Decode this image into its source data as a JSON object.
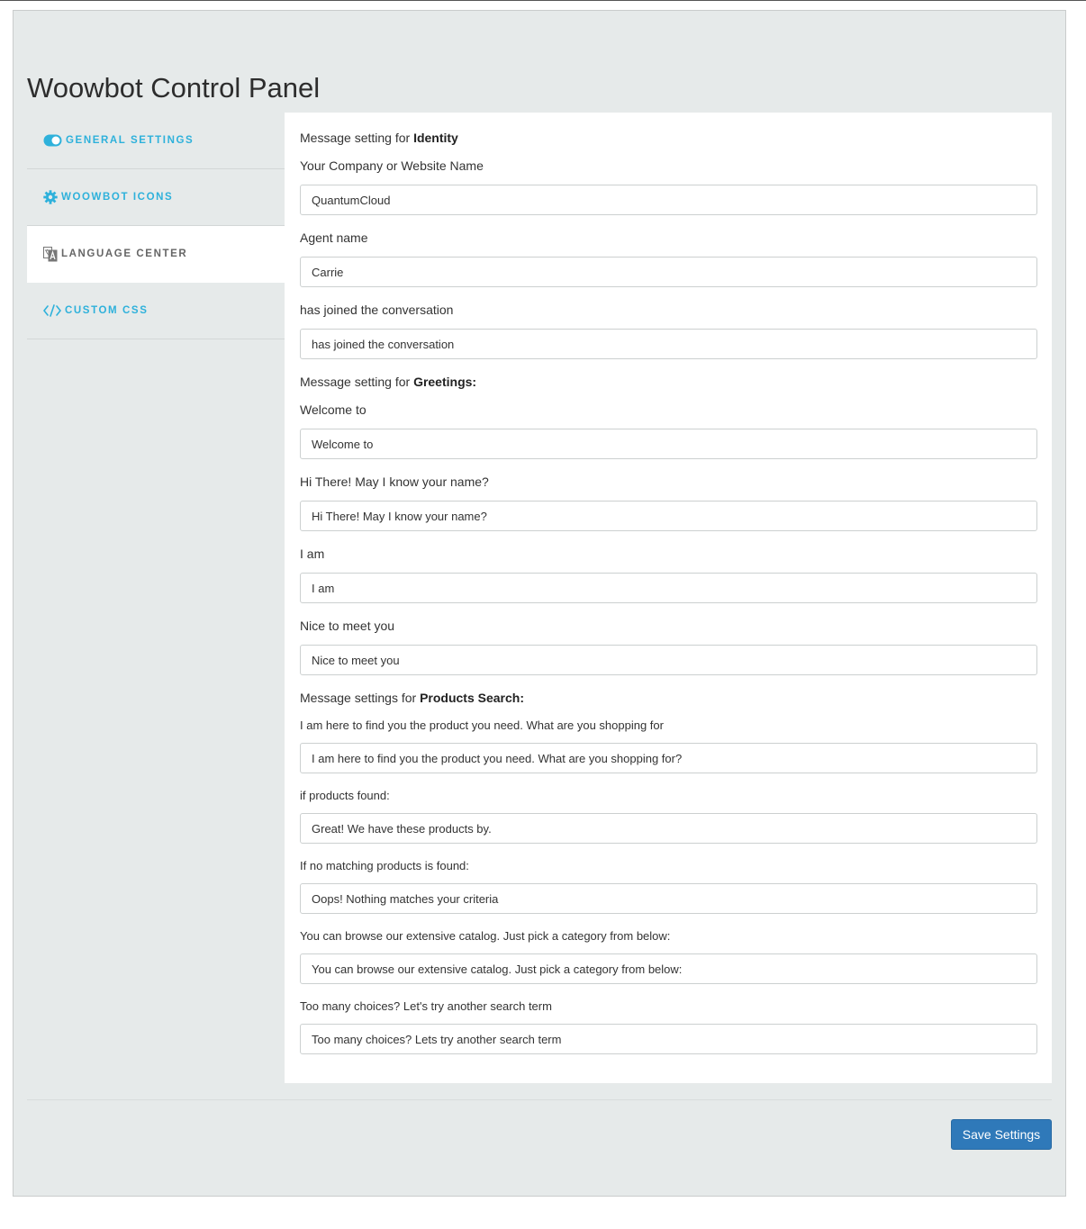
{
  "page": {
    "title": "Woowbot Control Panel"
  },
  "sidebar": {
    "items": [
      {
        "label": "GENERAL SETTINGS",
        "icon": "toggle-icon",
        "active": false
      },
      {
        "label": "WOOWBOT ICONS",
        "icon": "gear-icon",
        "active": false
      },
      {
        "label": "LANGUAGE CENTER",
        "icon": "translate-icon",
        "active": true
      },
      {
        "label": "CUSTOM CSS",
        "icon": "code-icon",
        "active": false
      }
    ]
  },
  "sections": {
    "identity": {
      "prefix": "Message setting for",
      "bold": "Identity"
    },
    "greetings": {
      "prefix": "Message setting for",
      "bold": "Greetings:"
    },
    "products": {
      "prefix": "Message settings for",
      "bold": "Products Search:"
    }
  },
  "fields": {
    "company_name": {
      "label": "Your Company or Website Name",
      "value": "QuantumCloud"
    },
    "agent_name": {
      "label": "Agent name",
      "value": "Carrie"
    },
    "joined": {
      "label": "has joined the conversation",
      "value": "has joined the conversation"
    },
    "welcome": {
      "label": "Welcome to",
      "value": "Welcome to"
    },
    "ask_name": {
      "label": "Hi There! May I know your name?",
      "value": "Hi There! May I know your name?"
    },
    "i_am": {
      "label": "I am",
      "value": "I am"
    },
    "nice_meet": {
      "label": "Nice to meet you",
      "value": "Nice to meet you"
    },
    "find_product": {
      "label": "I am here to find you the product you need. What are you shopping for",
      "value": "I am here to find you the product you need. What are you shopping for?"
    },
    "products_found": {
      "label": "if products found:",
      "value": "Great! We have these products by."
    },
    "no_match": {
      "label": "If no matching products is found:",
      "value": "Oops! Nothing matches your criteria"
    },
    "browse_catalog": {
      "label": "You can browse our extensive catalog. Just pick a category from below:",
      "value": "You can browse our extensive catalog. Just pick a category from below:"
    },
    "too_many": {
      "label": "Too many choices? Let's try another search term",
      "value": "Too many choices? Lets try another search term"
    }
  },
  "actions": {
    "save_label": "Save Settings"
  },
  "colors": {
    "accent": "#2eb1db",
    "button": "#2f79b9",
    "panel_bg": "#e6eaea"
  }
}
